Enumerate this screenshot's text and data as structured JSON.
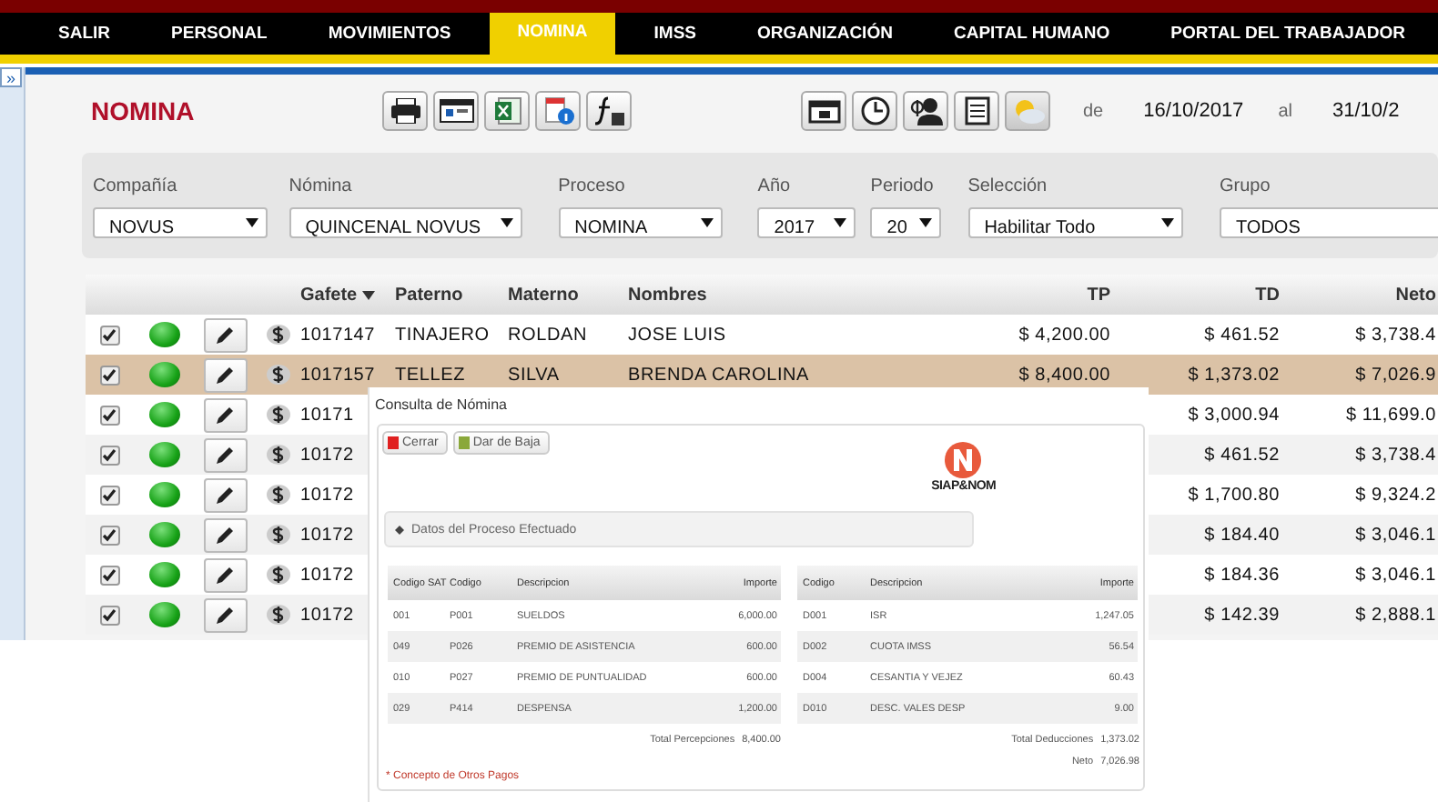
{
  "nav": {
    "tabs": [
      {
        "label": "SALIR",
        "selected": false
      },
      {
        "label": "PERSONAL",
        "selected": false
      },
      {
        "label": "MOVIMIENTOS",
        "selected": false
      },
      {
        "label": "NOMINA",
        "selected": true
      },
      {
        "label": "IMSS",
        "selected": false
      },
      {
        "label": "ORGANIZACIÓN",
        "selected": false
      },
      {
        "label": "CAPITAL HUMANO",
        "selected": false
      },
      {
        "label": "PORTAL DEL TRABAJADOR",
        "selected": false
      }
    ]
  },
  "sidebar_toggle": "»",
  "page": {
    "title": "NOMINA",
    "date_from_label": "de",
    "date_from": "16/10/2017",
    "date_to_label": "al",
    "date_to": "31/10/2"
  },
  "filters": [
    {
      "label": "Compañía",
      "value": "NOVUS"
    },
    {
      "label": "Nómina",
      "value": "QUINCENAL NOVUS"
    },
    {
      "label": "Proceso",
      "value": "NOMINA"
    },
    {
      "label": "Año",
      "value": "2017"
    },
    {
      "label": "Periodo",
      "value": "20"
    },
    {
      "label": "Selección",
      "value": "Habilitar Todo"
    },
    {
      "label": "Grupo",
      "value": "TODOS"
    }
  ],
  "table": {
    "columns": [
      "Gafete",
      "Paterno",
      "Materno",
      "Nombres",
      "TP",
      "TD",
      "Neto"
    ],
    "rows": [
      {
        "checked": true,
        "selected": false,
        "gafete": "1017147",
        "paterno": "TINAJERO",
        "materno": "ROLDAN",
        "nombres": "JOSE LUIS",
        "tp": "$ 4,200.00",
        "td": "$ 461.52",
        "neto": "$ 3,738.4"
      },
      {
        "checked": true,
        "selected": true,
        "gafete": "1017157",
        "paterno": "TELLEZ",
        "materno": "SILVA",
        "nombres": "BRENDA CAROLINA",
        "tp": "$ 8,400.00",
        "td": "$ 1,373.02",
        "neto": "$ 7,026.9"
      },
      {
        "checked": true,
        "selected": false,
        "gafete": "10171",
        "td": "$ 3,000.94",
        "neto": "$ 11,699.0"
      },
      {
        "checked": true,
        "selected": false,
        "gafete": "10172",
        "td": "$ 461.52",
        "neto": "$ 3,738.4"
      },
      {
        "checked": true,
        "selected": false,
        "gafete": "10172",
        "td": "$ 1,700.80",
        "neto": "$ 9,324.2"
      },
      {
        "checked": true,
        "selected": false,
        "gafete": "10172",
        "td": "$ 184.40",
        "neto": "$ 3,046.1"
      },
      {
        "checked": true,
        "selected": false,
        "gafete": "10172",
        "td": "$ 184.36",
        "neto": "$ 3,046.1"
      },
      {
        "checked": true,
        "selected": false,
        "gafete": "10172",
        "td": "$ 142.39",
        "neto": "$ 2,888.1"
      }
    ]
  },
  "dialog": {
    "title": "Consulta de Nómina",
    "buttons": [
      "Cerrar",
      "Dar de Baja"
    ],
    "logo_text": "SIAP&NOM",
    "section": "Datos del Proceso Efectuado",
    "perceptions": {
      "columns": [
        "Codigo SAT",
        "Codigo",
        "Descripcion",
        "Importe"
      ],
      "rows": [
        [
          "001",
          "P001",
          "SUELDOS",
          "6,000.00"
        ],
        [
          "049",
          "P026",
          "PREMIO DE ASISTENCIA",
          "600.00"
        ],
        [
          "010",
          "P027",
          "PREMIO DE PUNTUALIDAD",
          "600.00"
        ],
        [
          "029",
          "P414",
          "DESPENSA",
          "1,200.00"
        ]
      ],
      "total_label": "Total Percepciones",
      "total": "8,400.00"
    },
    "deductions": {
      "columns": [
        "Codigo",
        "Descripcion",
        "Importe"
      ],
      "rows": [
        [
          "D001",
          "ISR",
          "1,247.05"
        ],
        [
          "D002",
          "CUOTA IMSS",
          "56.54"
        ],
        [
          "D004",
          "CESANTIA Y VEJEZ",
          "60.43"
        ],
        [
          "D010",
          "DESC. VALES DESP",
          "9.00"
        ]
      ],
      "total_label": "Total Deducciones",
      "total": "1,373.02",
      "net_label": "Neto",
      "net": "7,026.98"
    },
    "footnote": "* Concepto de Otros Pagos"
  }
}
